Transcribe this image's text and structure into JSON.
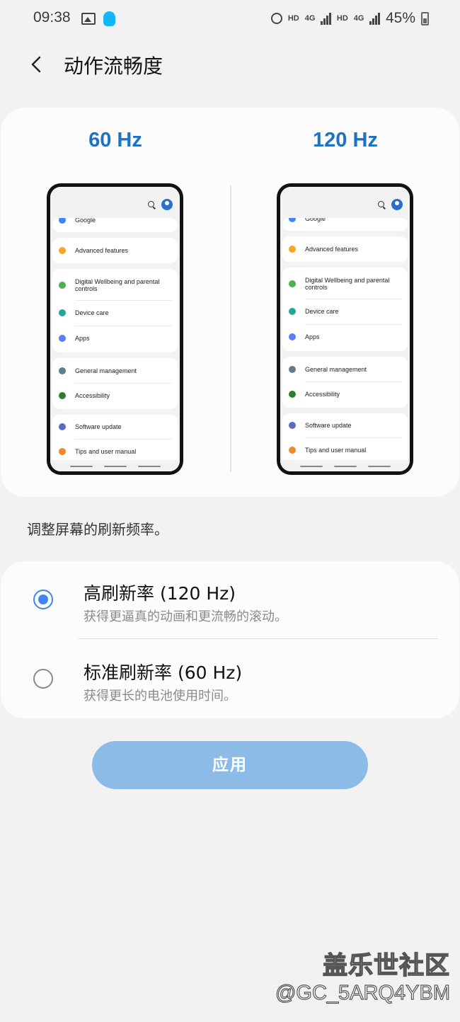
{
  "status_bar": {
    "time": "09:38",
    "hd1": "HD",
    "net1": "4G",
    "hd2": "HD",
    "net2": "4G",
    "battery": "45%"
  },
  "header": {
    "title": "动作流畅度"
  },
  "preview": {
    "left_label": "60 Hz",
    "right_label": "120 Hz",
    "mini_items": {
      "google": "Google",
      "advanced": "Advanced features",
      "wellbeing": "Digital Wellbeing and parental controls",
      "device_care": "Device care",
      "apps": "Apps",
      "general": "General management",
      "accessibility": "Accessibility",
      "software": "Software update",
      "tips": "Tips and user manual"
    },
    "icon_colors": {
      "google": "#4285f4",
      "advanced": "#f5a623",
      "wellbeing": "#4caf50",
      "device_care": "#26a69a",
      "apps": "#5c7cfa",
      "general": "#607d8b",
      "accessibility": "#2e7d32",
      "software": "#5c6bc0",
      "tips": "#ef8a2c"
    }
  },
  "description": "调整屏幕的刷新频率。",
  "options": [
    {
      "title": "高刷新率 (120 Hz)",
      "subtitle": "获得更逼真的动画和更流畅的滚动。",
      "selected": true
    },
    {
      "title": "标准刷新率 (60 Hz)",
      "subtitle": "获得更长的电池使用时间。",
      "selected": false
    }
  ],
  "apply_label": "应用",
  "watermark": {
    "site": "盖乐世社区",
    "user": "@GC_5ARQ4YBM"
  },
  "colors": {
    "accent": "#1c73c2",
    "radio": "#3d86ef",
    "apply_disabled": "#8dbbe7"
  }
}
